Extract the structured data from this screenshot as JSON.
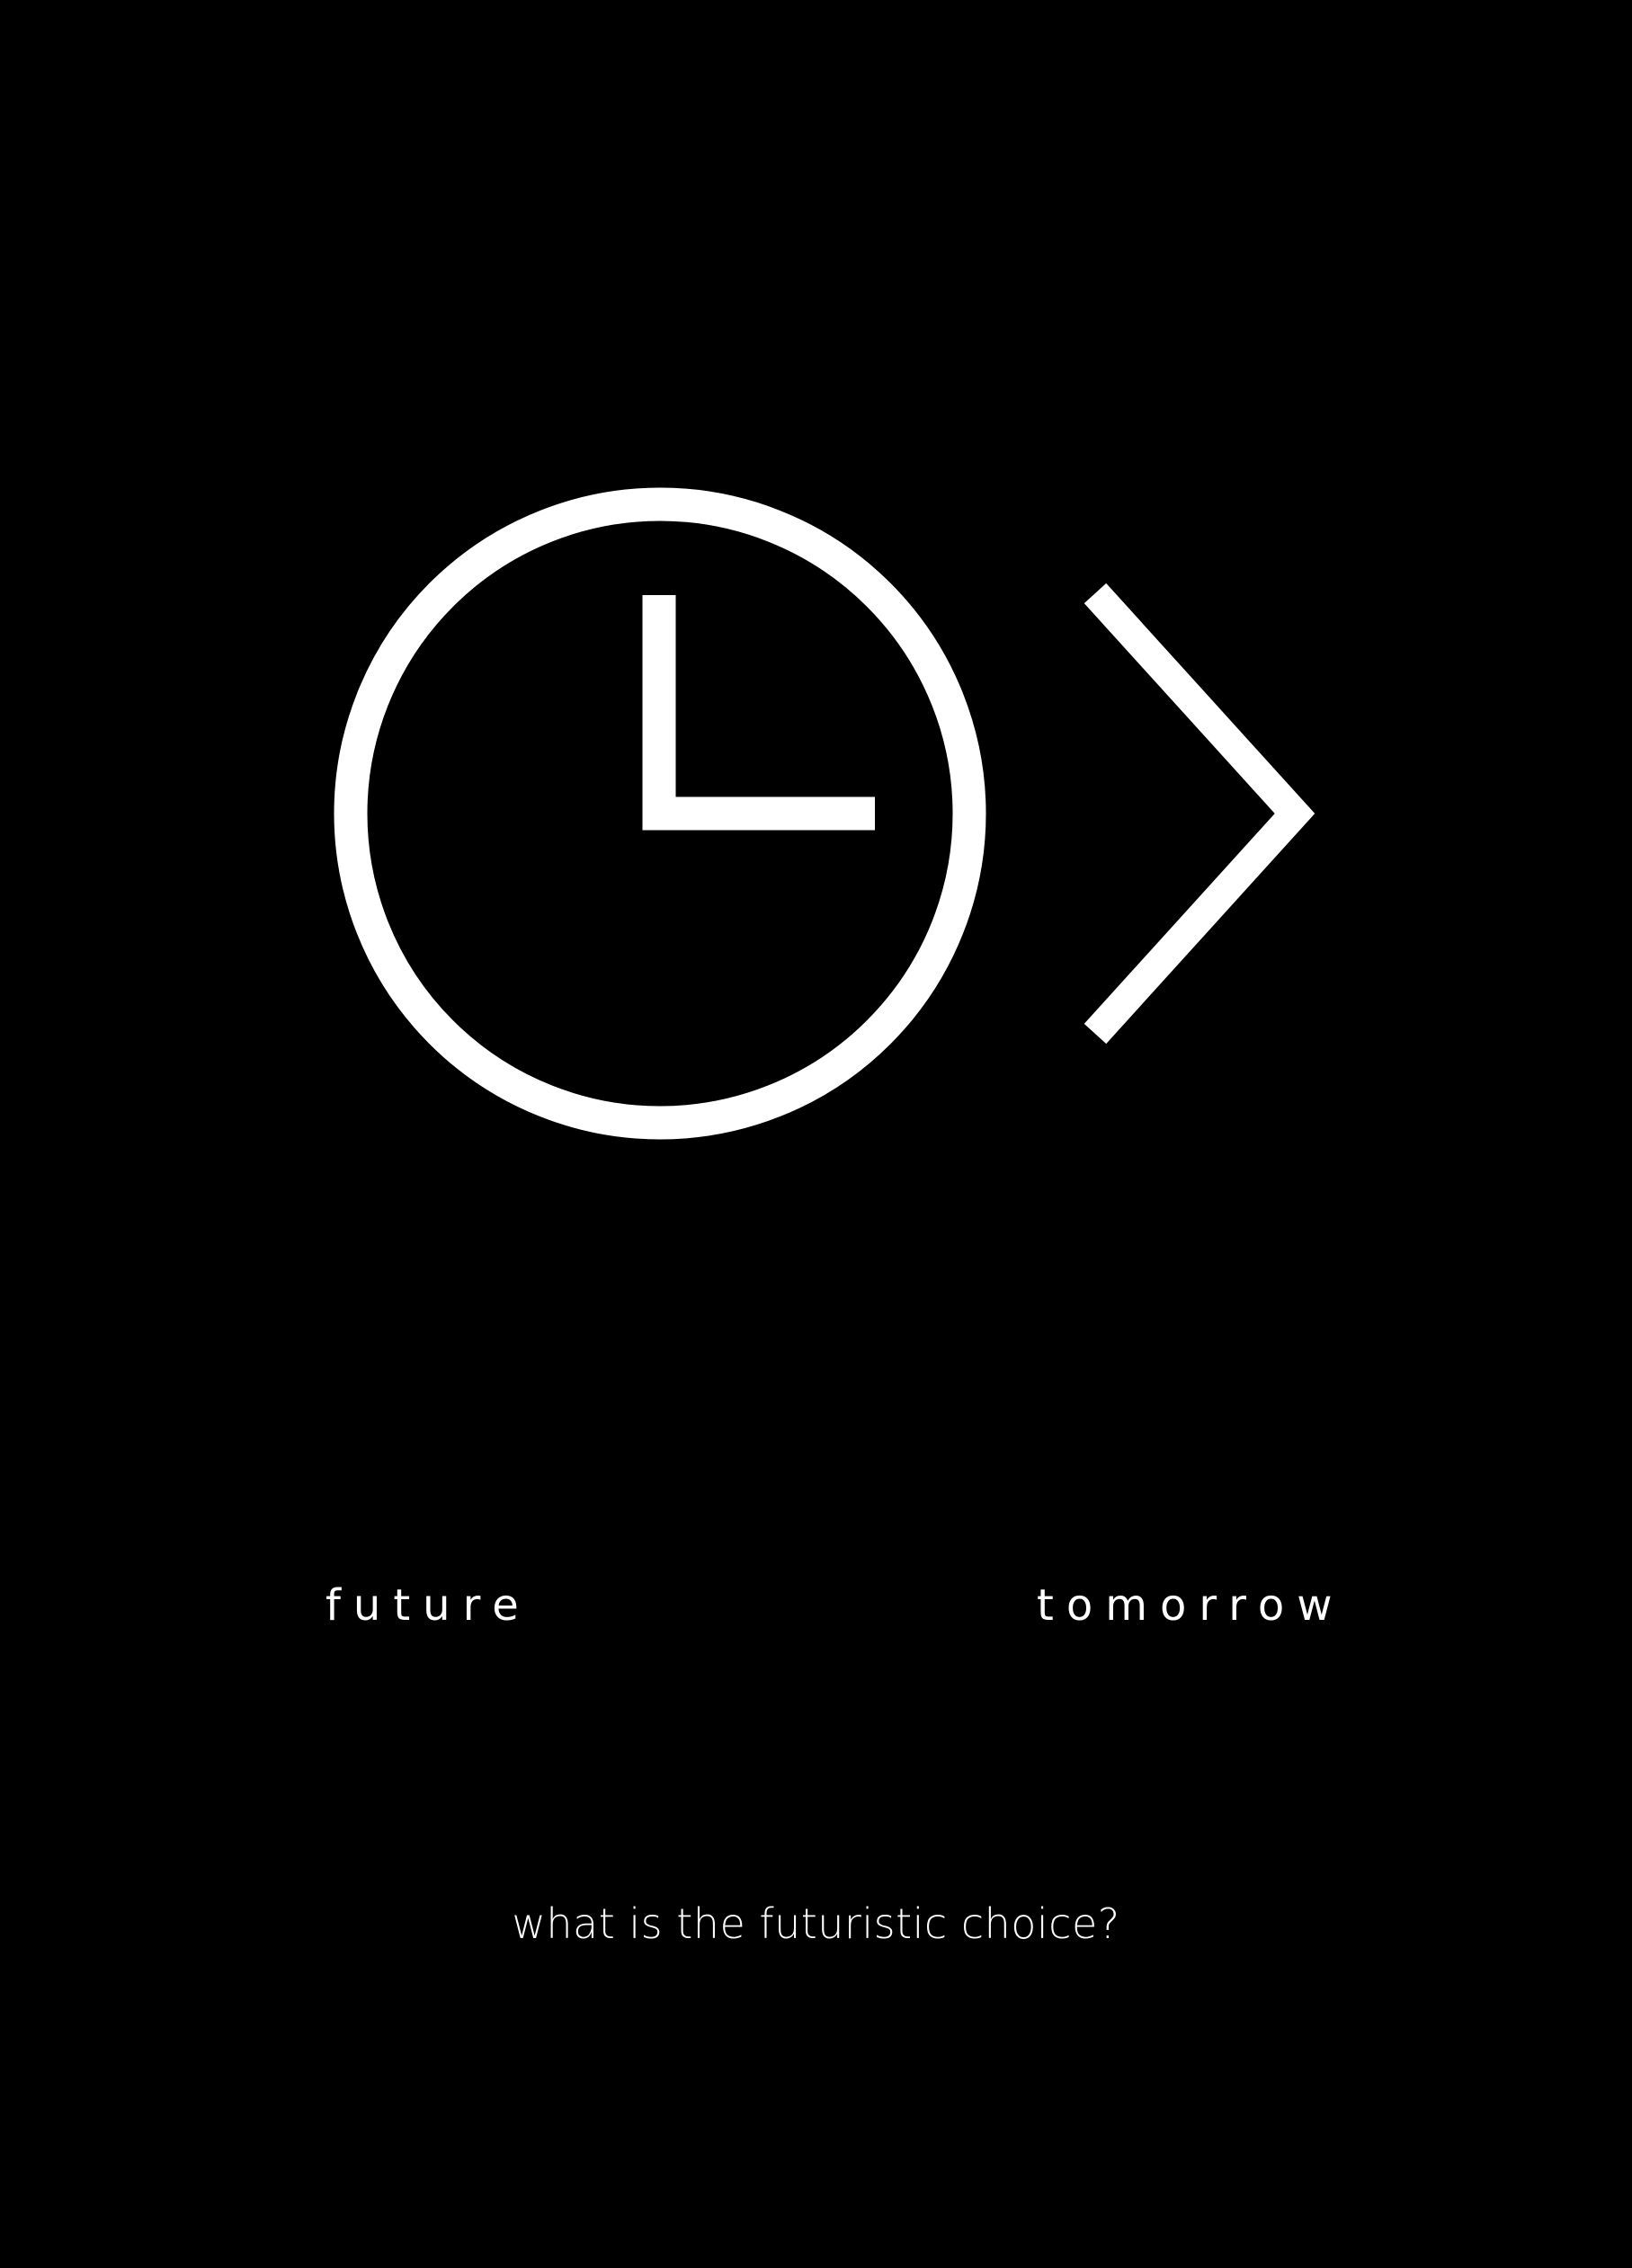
{
  "poster": {
    "background_color": "#000000",
    "foreground_color": "#ffffff",
    "left_word": "future",
    "right_word": "tomorrow",
    "question": "what is the futuristic choice?"
  },
  "icons": {
    "clock": "clock-icon",
    "arrow": "chevron-right-icon"
  }
}
